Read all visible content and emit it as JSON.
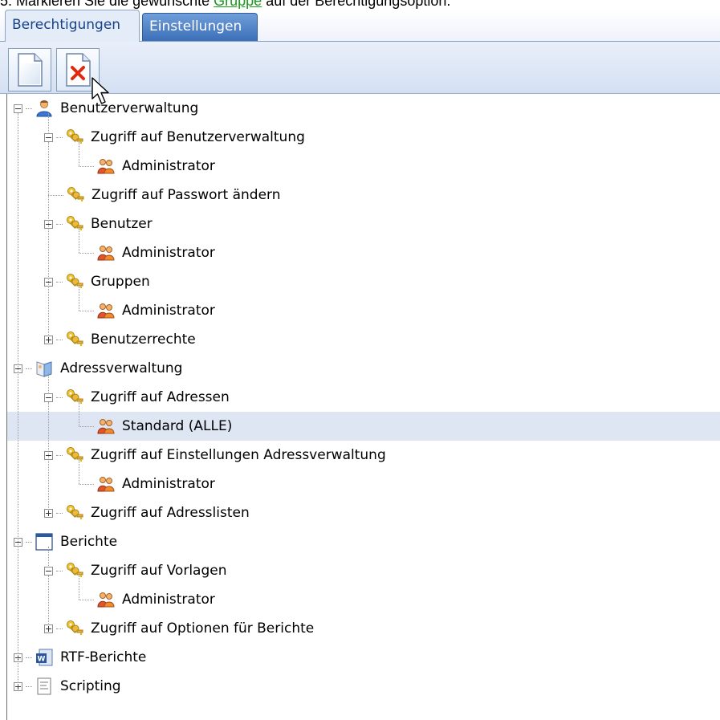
{
  "instruction": {
    "prefix": "5. Markieren Sie die gewünschte ",
    "link": "Gruppe",
    "suffix": " auf der Berechtigungsoption."
  },
  "tabs": [
    {
      "label": "Berechtigungen",
      "active": true
    },
    {
      "label": "Einstellungen",
      "active": false
    }
  ],
  "toolbar": {
    "new_icon": "new-document-icon",
    "delete_icon": "delete-icon"
  },
  "tree": [
    {
      "label": "Benutzerverwaltung",
      "icon": "user-admin-icon",
      "level": 0,
      "expander": "minus"
    },
    {
      "label": "Zugriff auf Benutzerverwaltung",
      "icon": "keys-icon",
      "level": 1,
      "expander": "minus"
    },
    {
      "label": "Administrator",
      "icon": "group-icon",
      "level": 2,
      "expander": "none"
    },
    {
      "label": "Zugriff auf Passwort ändern",
      "icon": "keys-icon",
      "level": 1,
      "expander": "none"
    },
    {
      "label": "Benutzer",
      "icon": "keys-icon",
      "level": 1,
      "expander": "minus"
    },
    {
      "label": "Administrator",
      "icon": "group-icon",
      "level": 2,
      "expander": "none"
    },
    {
      "label": "Gruppen",
      "icon": "keys-icon",
      "level": 1,
      "expander": "minus"
    },
    {
      "label": "Administrator",
      "icon": "group-icon",
      "level": 2,
      "expander": "none"
    },
    {
      "label": "Benutzerrechte",
      "icon": "keys-icon",
      "level": 1,
      "expander": "plus"
    },
    {
      "label": "Adressverwaltung",
      "icon": "address-book-icon",
      "level": 0,
      "expander": "minus"
    },
    {
      "label": "Zugriff auf Adressen",
      "icon": "keys-icon",
      "level": 1,
      "expander": "minus"
    },
    {
      "label": "Standard (ALLE)",
      "icon": "group-icon",
      "level": 2,
      "expander": "none",
      "selected": true
    },
    {
      "label": "Zugriff auf Einstellungen Adressverwaltung",
      "icon": "keys-icon",
      "level": 1,
      "expander": "minus"
    },
    {
      "label": "Administrator",
      "icon": "group-icon",
      "level": 2,
      "expander": "none"
    },
    {
      "label": "Zugriff auf Adresslisten",
      "icon": "keys-icon",
      "level": 1,
      "expander": "plus"
    },
    {
      "label": "Berichte",
      "icon": "report-window-icon",
      "level": 0,
      "expander": "minus"
    },
    {
      "label": "Zugriff auf Vorlagen",
      "icon": "keys-icon",
      "level": 1,
      "expander": "minus"
    },
    {
      "label": "Administrator",
      "icon": "group-icon",
      "level": 2,
      "expander": "none"
    },
    {
      "label": "Zugriff auf Optionen für Berichte",
      "icon": "keys-icon",
      "level": 1,
      "expander": "plus"
    },
    {
      "label": "RTF-Berichte",
      "icon": "word-document-icon",
      "level": 0,
      "expander": "plus"
    },
    {
      "label": "Scripting",
      "icon": "script-icon",
      "level": 0,
      "expander": "plus"
    }
  ],
  "colors": {
    "tab_active_text": "#15428b",
    "tab_inactive_bg": "#4a7fc6",
    "selection": "#dde6f2",
    "link": "#1a9a1a"
  }
}
